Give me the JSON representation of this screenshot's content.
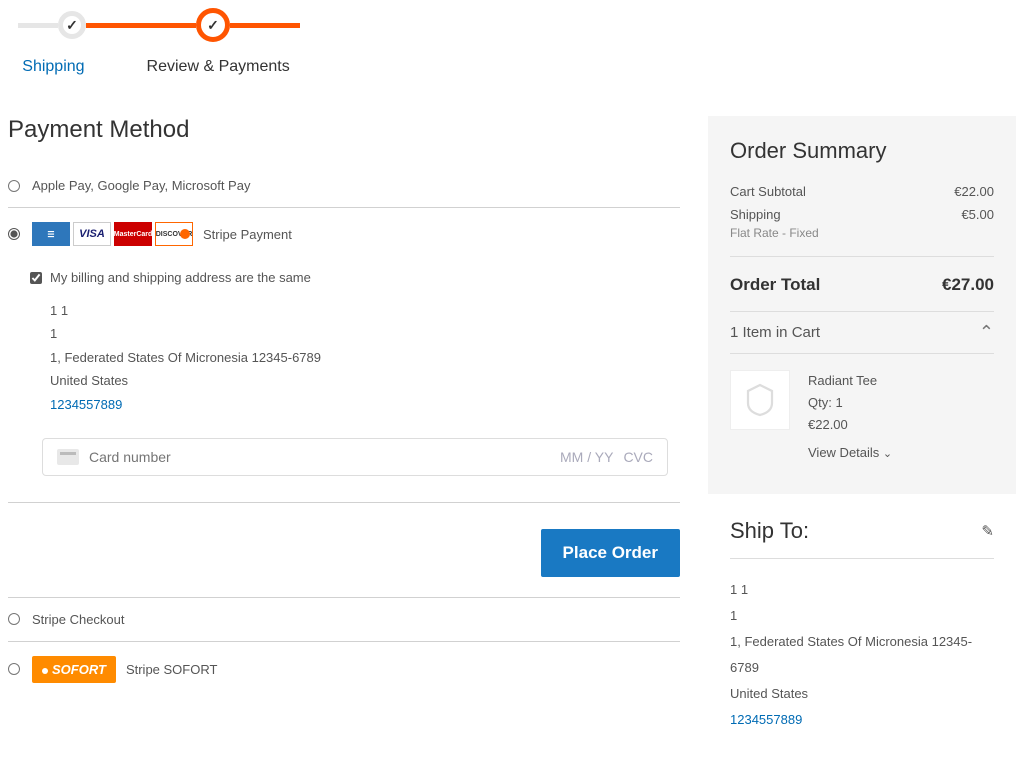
{
  "progress": {
    "shipping_label": "Shipping",
    "review_label": "Review & Payments"
  },
  "payment": {
    "heading": "Payment Method",
    "apple_google_ms": "Apple Pay, Google Pay, Microsoft Pay",
    "stripe_payment": "Stripe Payment",
    "billing_same_label": "My billing and shipping address are the same",
    "address": {
      "name": "1 1",
      "line1": "1",
      "line2": "1, Federated States Of Micronesia 12345-6789",
      "country": "United States",
      "phone": "1234557889"
    },
    "card_placeholder": "Card number",
    "card_mmyy": "MM / YY",
    "card_cvc": "CVC",
    "place_order": "Place Order",
    "stripe_checkout": "Stripe Checkout",
    "stripe_sofort": "Stripe SOFORT",
    "sofort_badge": "SOFORT"
  },
  "summary": {
    "title": "Order Summary",
    "subtotal_label": "Cart Subtotal",
    "subtotal_value": "€22.00",
    "shipping_label": "Shipping",
    "shipping_sub": "Flat Rate - Fixed",
    "shipping_value": "€5.00",
    "total_label": "Order Total",
    "total_value": "€27.00",
    "cart_count": "1 Item in Cart",
    "item": {
      "name": "Radiant Tee",
      "qty": "Qty: 1",
      "price": "€22.00",
      "view_details": "View Details"
    }
  },
  "shipto": {
    "title": "Ship To:",
    "name": "1 1",
    "line1": "1",
    "line2": "1, Federated States Of Micronesia 12345-6789",
    "country": "United States",
    "phone": "1234557889"
  }
}
